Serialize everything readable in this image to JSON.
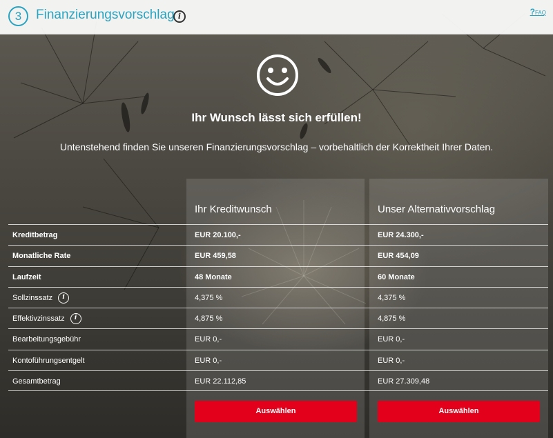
{
  "header": {
    "step_number": "3",
    "title": "Finanzierungsvorschlag",
    "faq_label": "FAQ",
    "faq_prefix": "?"
  },
  "main": {
    "headline": "Ihr Wunsch lässt sich erfüllen!",
    "subline": "Untenstehend finden Sie unseren Finanzierungsvorschlag – vorbehaltlich der Korrektheit Ihrer Daten.",
    "columns": [
      {
        "title": "Ihr Kreditwunsch",
        "button_label": "Auswählen"
      },
      {
        "title": "Unser Alternativvorschlag",
        "button_label": "Auswählen"
      }
    ],
    "rows": [
      {
        "label": "Kreditbetrag",
        "v1": "EUR 20.100,-",
        "v2": "EUR 24.300,-",
        "bold": true
      },
      {
        "label": "Monatliche Rate",
        "v1": "EUR 459,58",
        "v2": "EUR 454,09",
        "bold": true
      },
      {
        "label": "Laufzeit",
        "v1": "48 Monate",
        "v2": "60 Monate",
        "bold": true
      },
      {
        "label": "Sollzinssatz",
        "v1": "4,375 %",
        "v2": "4,375 %",
        "info": true
      },
      {
        "label": "Effektivzinssatz",
        "v1": "4,875 %",
        "v2": "4,875 %",
        "info": true
      },
      {
        "label": "Bearbeitungsgebühr",
        "v1": "EUR 0,-",
        "v2": "EUR 0,-"
      },
      {
        "label": "Kontoführungsentgelt",
        "v1": "EUR 0,-",
        "v2": "EUR 0,-"
      },
      {
        "label": "Gesamtbetrag",
        "v1": "EUR 22.112,85",
        "v2": "EUR 27.309,48"
      }
    ]
  },
  "colors": {
    "accent": "#2aa3c0",
    "button": "#e2001a"
  }
}
